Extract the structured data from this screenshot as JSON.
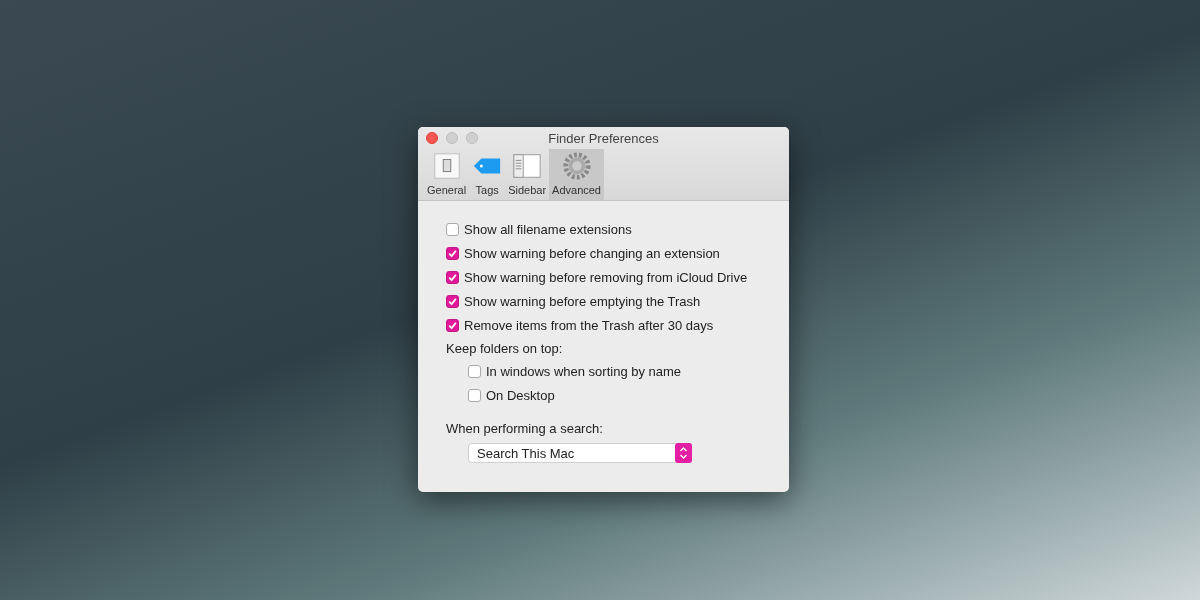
{
  "window": {
    "title": "Finder Preferences"
  },
  "tabs": [
    {
      "label": "General",
      "kind": "general",
      "selected": false
    },
    {
      "label": "Tags",
      "kind": "tags",
      "selected": false
    },
    {
      "label": "Sidebar",
      "kind": "sidebar",
      "selected": false
    },
    {
      "label": "Advanced",
      "kind": "advanced",
      "selected": true
    }
  ],
  "options": [
    {
      "label": "Show all filename extensions",
      "checked": false
    },
    {
      "label": "Show warning before changing an extension",
      "checked": true
    },
    {
      "label": "Show warning before removing from iCloud Drive",
      "checked": true
    },
    {
      "label": "Show warning before emptying the Trash",
      "checked": true
    },
    {
      "label": "Remove items from the Trash after 30 days",
      "checked": true
    }
  ],
  "folders": {
    "label": "Keep folders on top:",
    "options": [
      {
        "label": "In windows when sorting by name",
        "checked": false
      },
      {
        "label": "On Desktop",
        "checked": false
      }
    ]
  },
  "search": {
    "label": "When performing a search:",
    "value": "Search This Mac"
  }
}
